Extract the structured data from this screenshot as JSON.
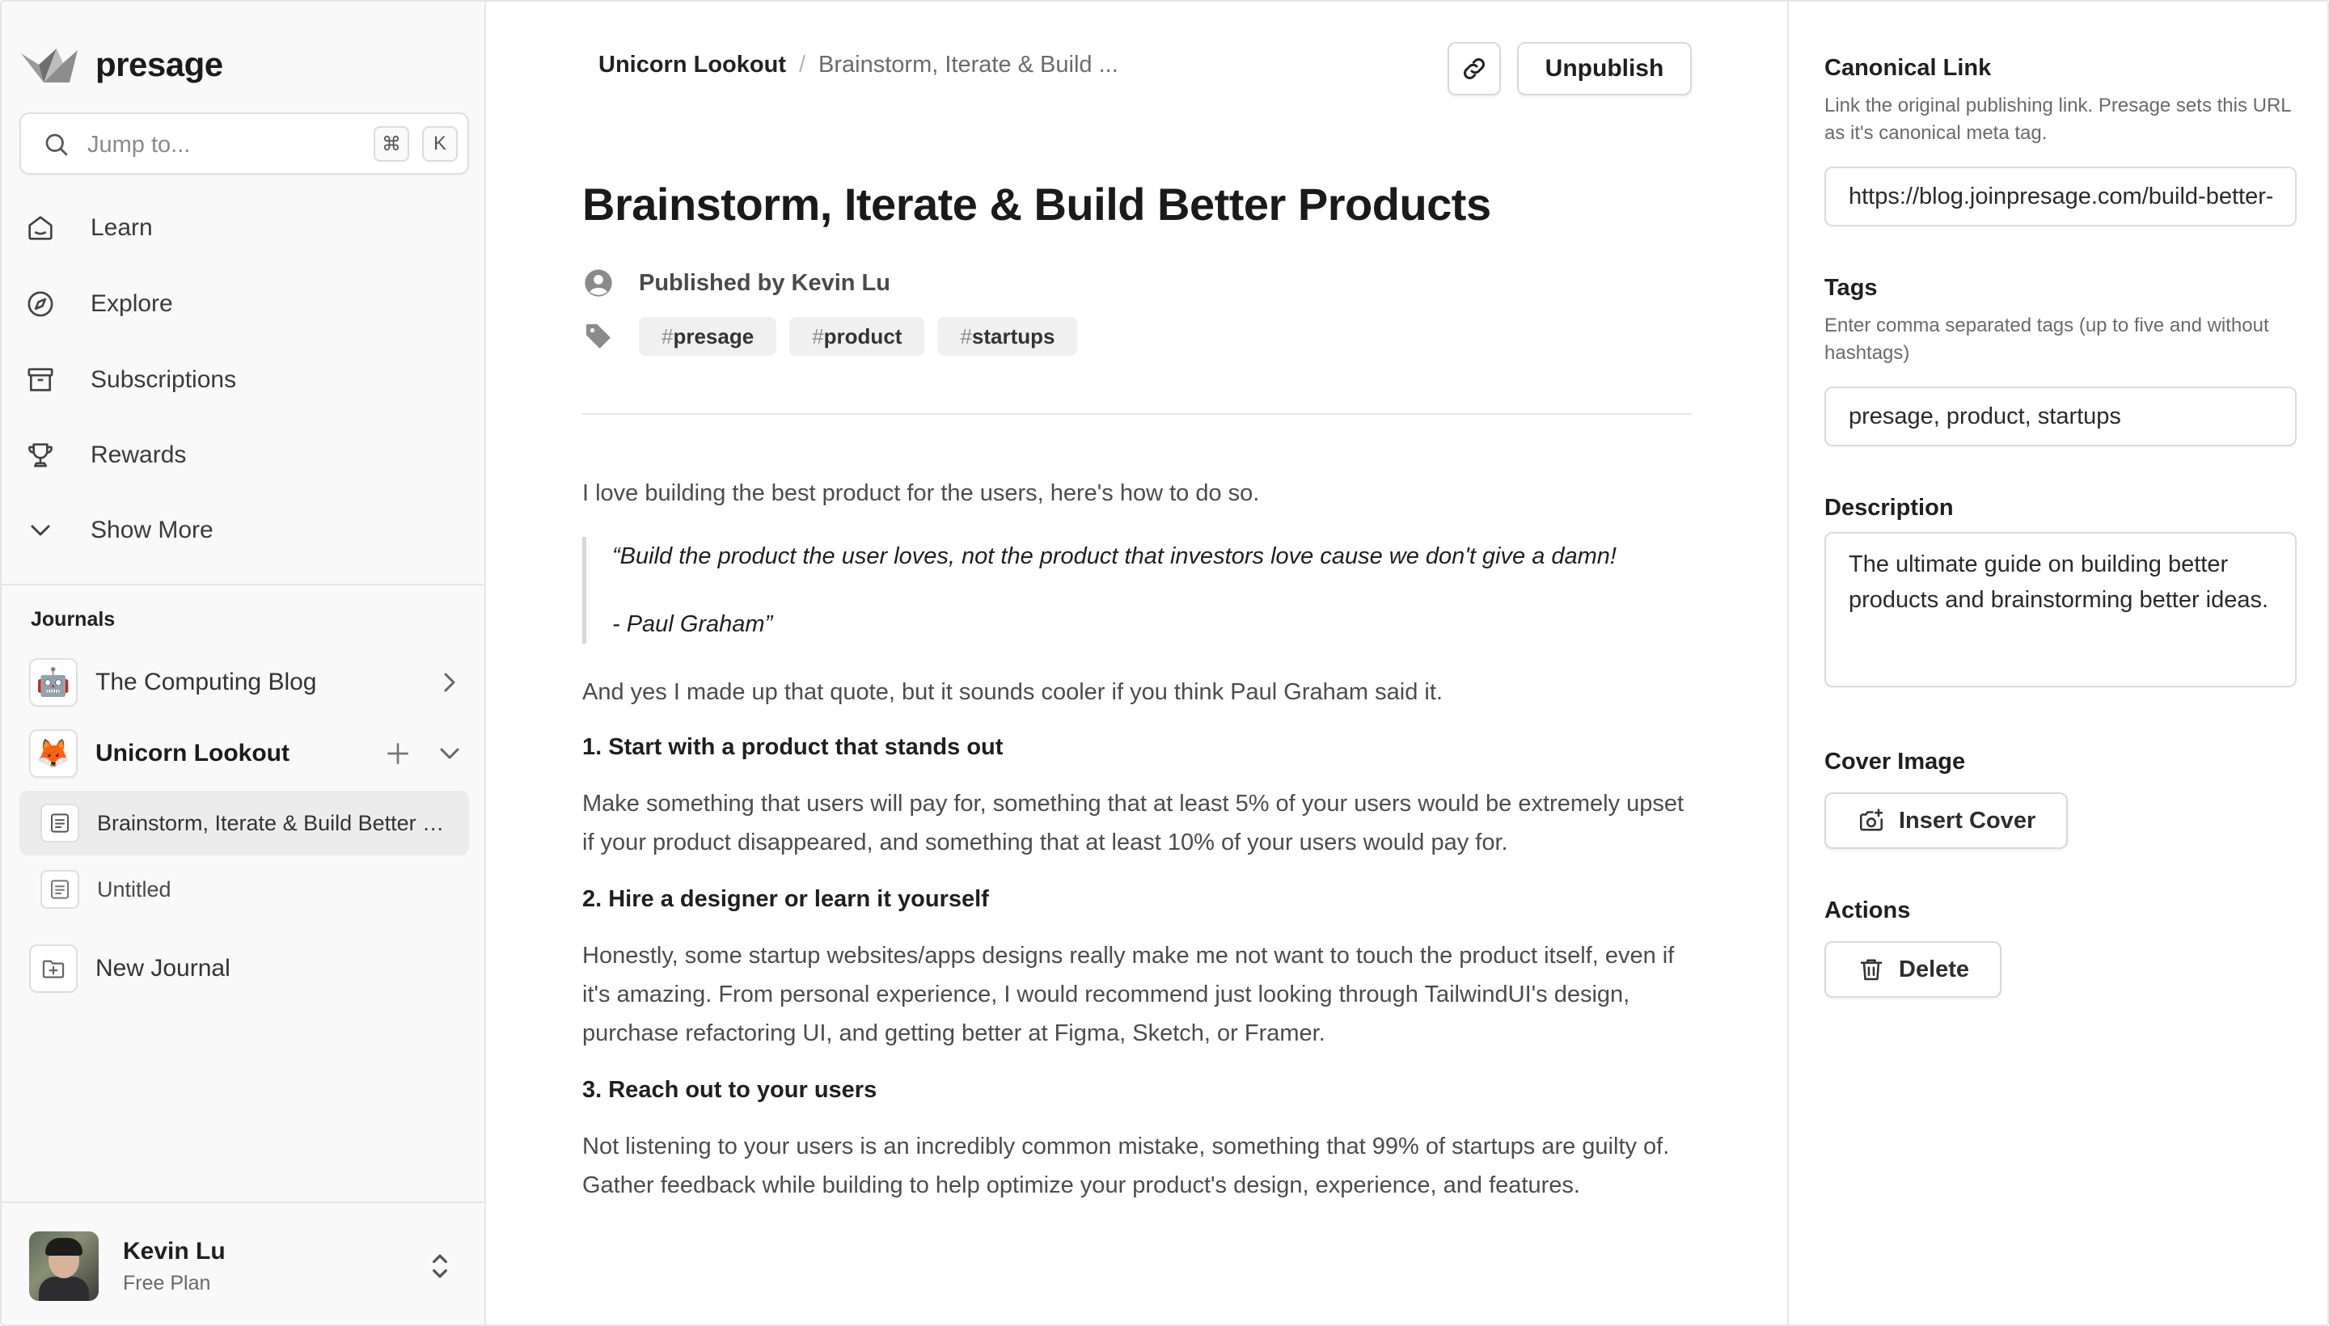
{
  "brand": {
    "name": "presage"
  },
  "search": {
    "placeholder": "Jump to...",
    "shortcut_mod": "⌘",
    "shortcut_key": "K"
  },
  "nav": {
    "items": [
      {
        "label": "Learn",
        "icon": "home-icon"
      },
      {
        "label": "Explore",
        "icon": "compass-icon"
      },
      {
        "label": "Subscriptions",
        "icon": "archive-icon"
      },
      {
        "label": "Rewards",
        "icon": "trophy-icon"
      },
      {
        "label": "Show More",
        "icon": "chevron-down-icon"
      }
    ]
  },
  "journals": {
    "title": "Journals",
    "items": [
      {
        "label": "The Computing Blog",
        "emoji": "🤖"
      },
      {
        "label": "Unicorn Lookout",
        "emoji": "🦊"
      }
    ],
    "posts": [
      {
        "label": "Brainstorm, Iterate & Build Better Products"
      },
      {
        "label": "Untitled"
      }
    ],
    "new_label": "New Journal"
  },
  "user": {
    "name": "Kevin Lu",
    "plan": "Free Plan"
  },
  "header": {
    "breadcrumb_root": "Unicorn Lookout",
    "breadcrumb_sep": "/",
    "breadcrumb_current": "Brainstorm, Iterate & Build ...",
    "unpublish_label": "Unpublish"
  },
  "article": {
    "title": "Brainstorm, Iterate & Build Better Products",
    "published_by": "Published by Kevin Lu",
    "tags": [
      "presage",
      "product",
      "startups"
    ],
    "tag_prefix": "#",
    "intro": "I love building the best product for the users, here's how to do so.",
    "quote_line1": "“Build the product the user loves, not the product that investors love cause we don't give a damn!",
    "quote_line2": "- Paul Graham”",
    "after_quote": "And yes I made up that quote, but it sounds cooler if you think Paul Graham said it.",
    "sections": [
      {
        "heading": "1. Start with a product that stands out",
        "body": "Make something that users will pay for, something that at least 5% of your users would be extremely upset if your product disappeared, and something that at least 10% of your users would pay for."
      },
      {
        "heading": "2. Hire a designer or learn it yourself",
        "body": "Honestly, some startup websites/apps designs really make me not want to touch the product itself, even if it's amazing. From personal experience, I would recommend just looking through TailwindUI's design, purchase refactoring UI, and getting better at Figma, Sketch, or Framer."
      },
      {
        "heading": "3. Reach out to your users",
        "body": "Not listening to your users is an incredibly common mistake, something that 99% of startups are guilty of. Gather feedback while building to help optimize your product's design, experience, and features."
      }
    ]
  },
  "panel": {
    "canonical": {
      "label": "Canonical Link",
      "help": "Link the original publishing link. Presage sets this URL as it's canonical meta tag.",
      "value": "https://blog.joinpresage.com/build-better-products"
    },
    "tags": {
      "label": "Tags",
      "help": "Enter comma separated tags (up to five and without hashtags)",
      "value": "presage, product, startups"
    },
    "description": {
      "label": "Description",
      "value": "The ultimate guide on building better products and brainstorming better ideas."
    },
    "cover": {
      "label": "Cover Image",
      "button": "Insert Cover"
    },
    "actions": {
      "label": "Actions",
      "delete": "Delete"
    }
  }
}
